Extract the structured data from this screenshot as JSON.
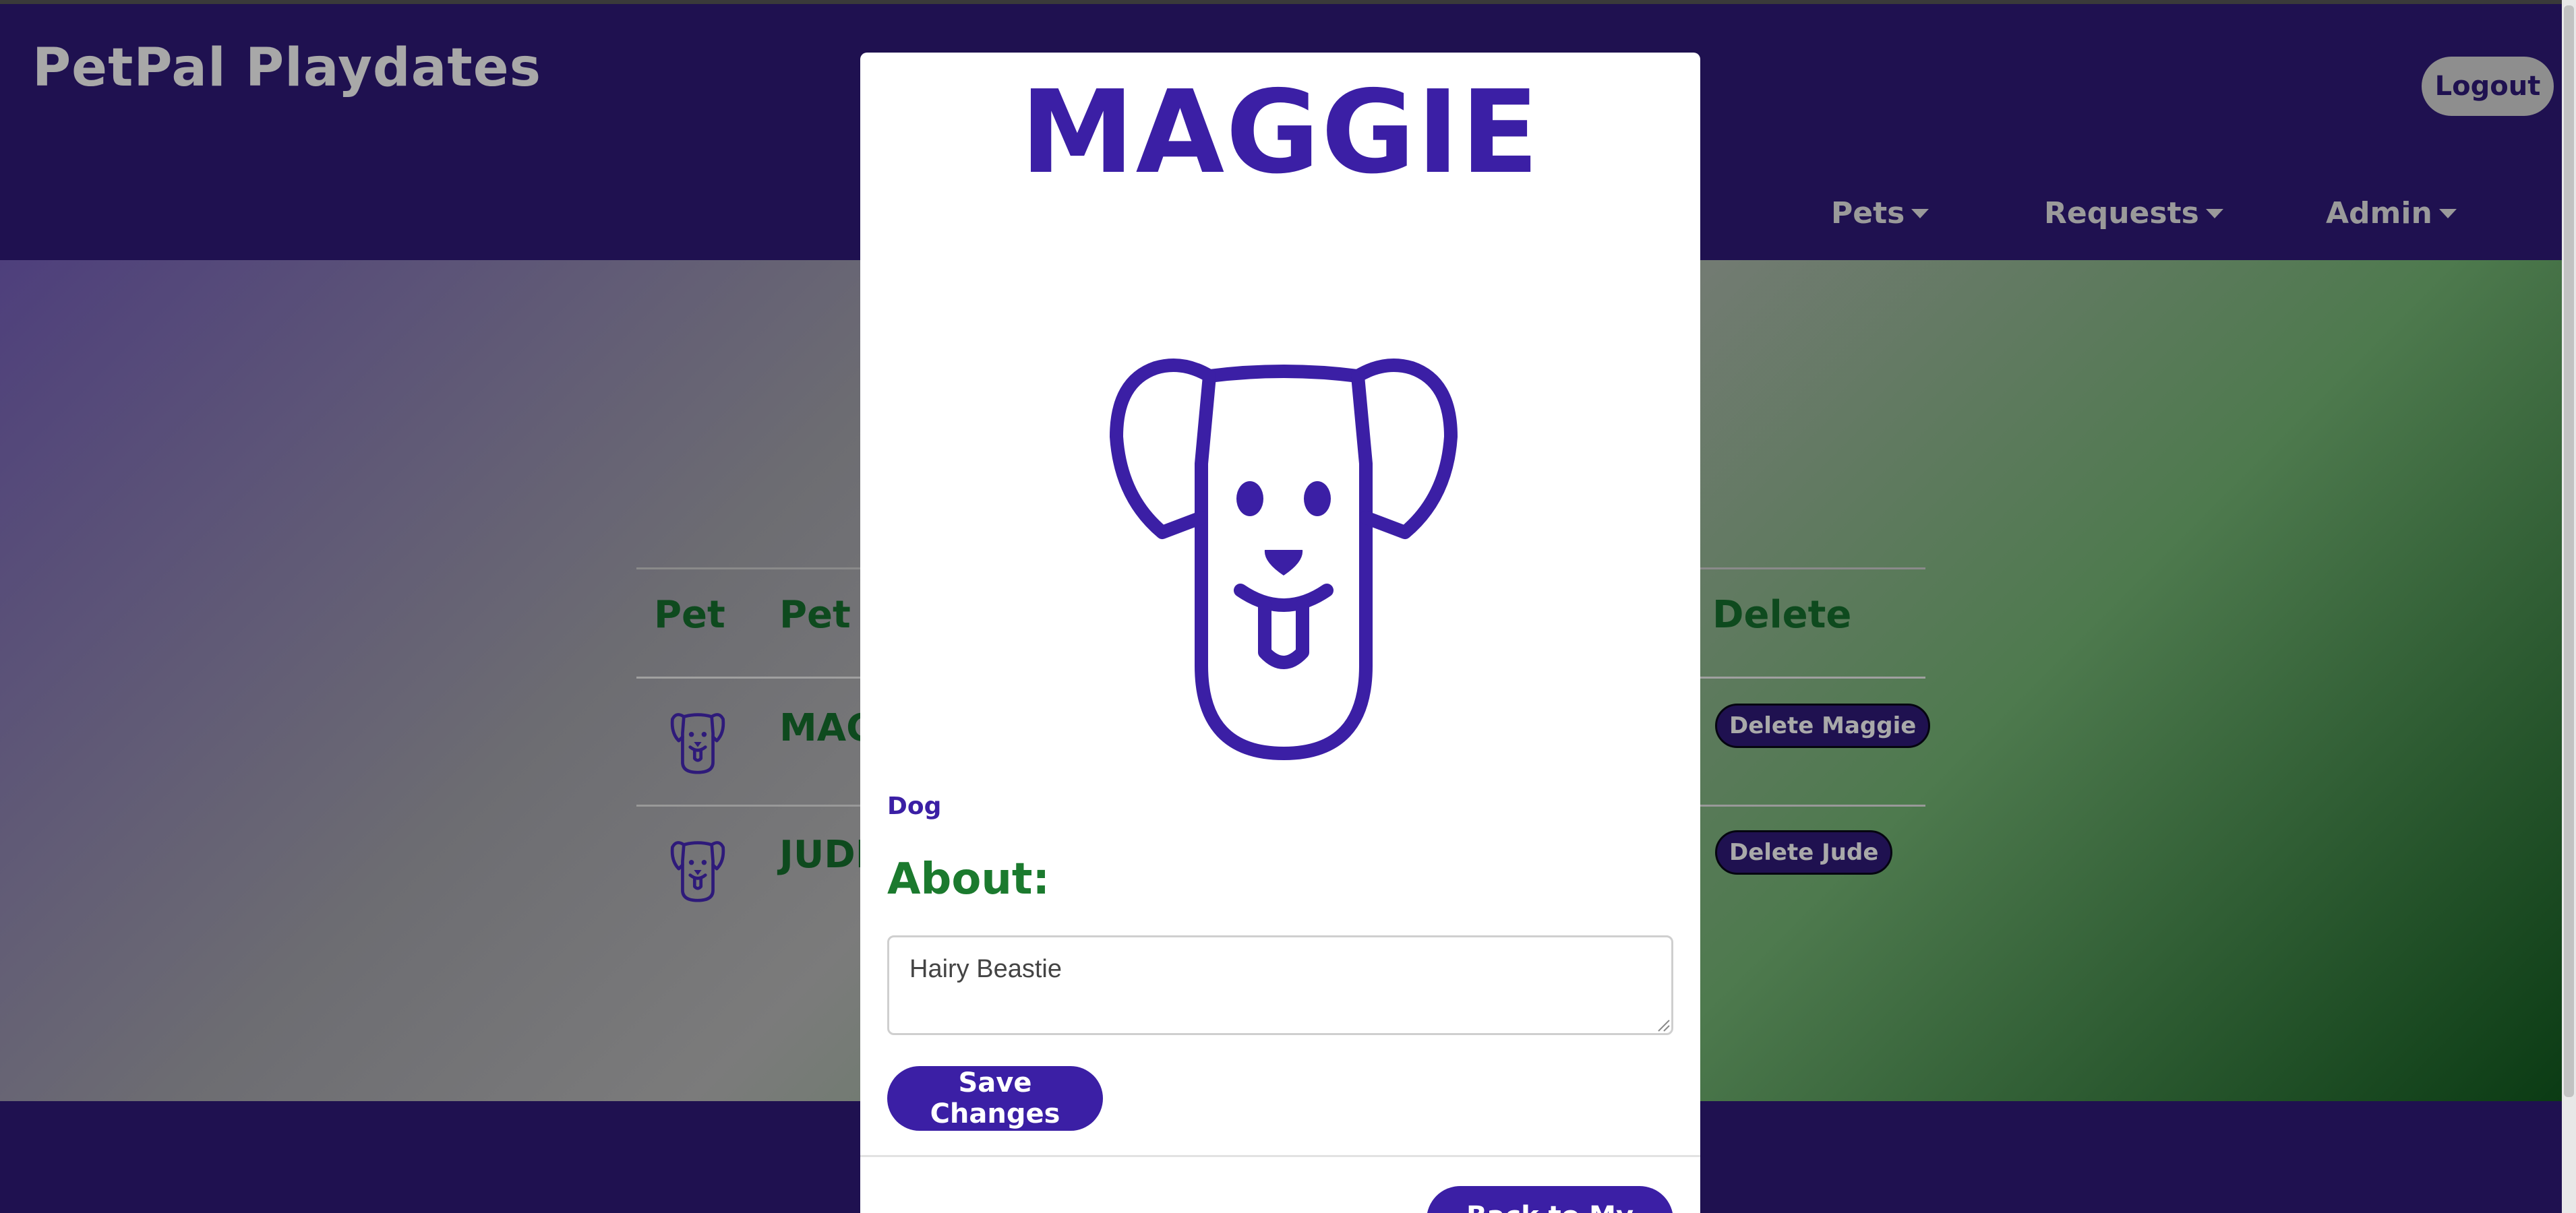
{
  "navbar": {
    "brand": "PetPal Playdates",
    "logout_label": "Logout",
    "menus": [
      "Pets",
      "Requests",
      "Admin"
    ]
  },
  "table": {
    "headers": [
      "Pet",
      "Pet N",
      "Delete"
    ],
    "rows": [
      {
        "name": "MAG",
        "delete_label": "Delete Maggie"
      },
      {
        "name": "JUDE",
        "delete_label": "Delete Jude"
      }
    ]
  },
  "modal": {
    "title": "MAGGIE",
    "species": "Dog",
    "about_heading": "About:",
    "about_text": "Hairy Beastie",
    "save_label": "Save Changes",
    "back_label": "Back to My Pets"
  },
  "colors": {
    "navbar": "#1f1150",
    "accent_purple": "#3b1fa5",
    "heading_green": "#1b7a2e"
  }
}
